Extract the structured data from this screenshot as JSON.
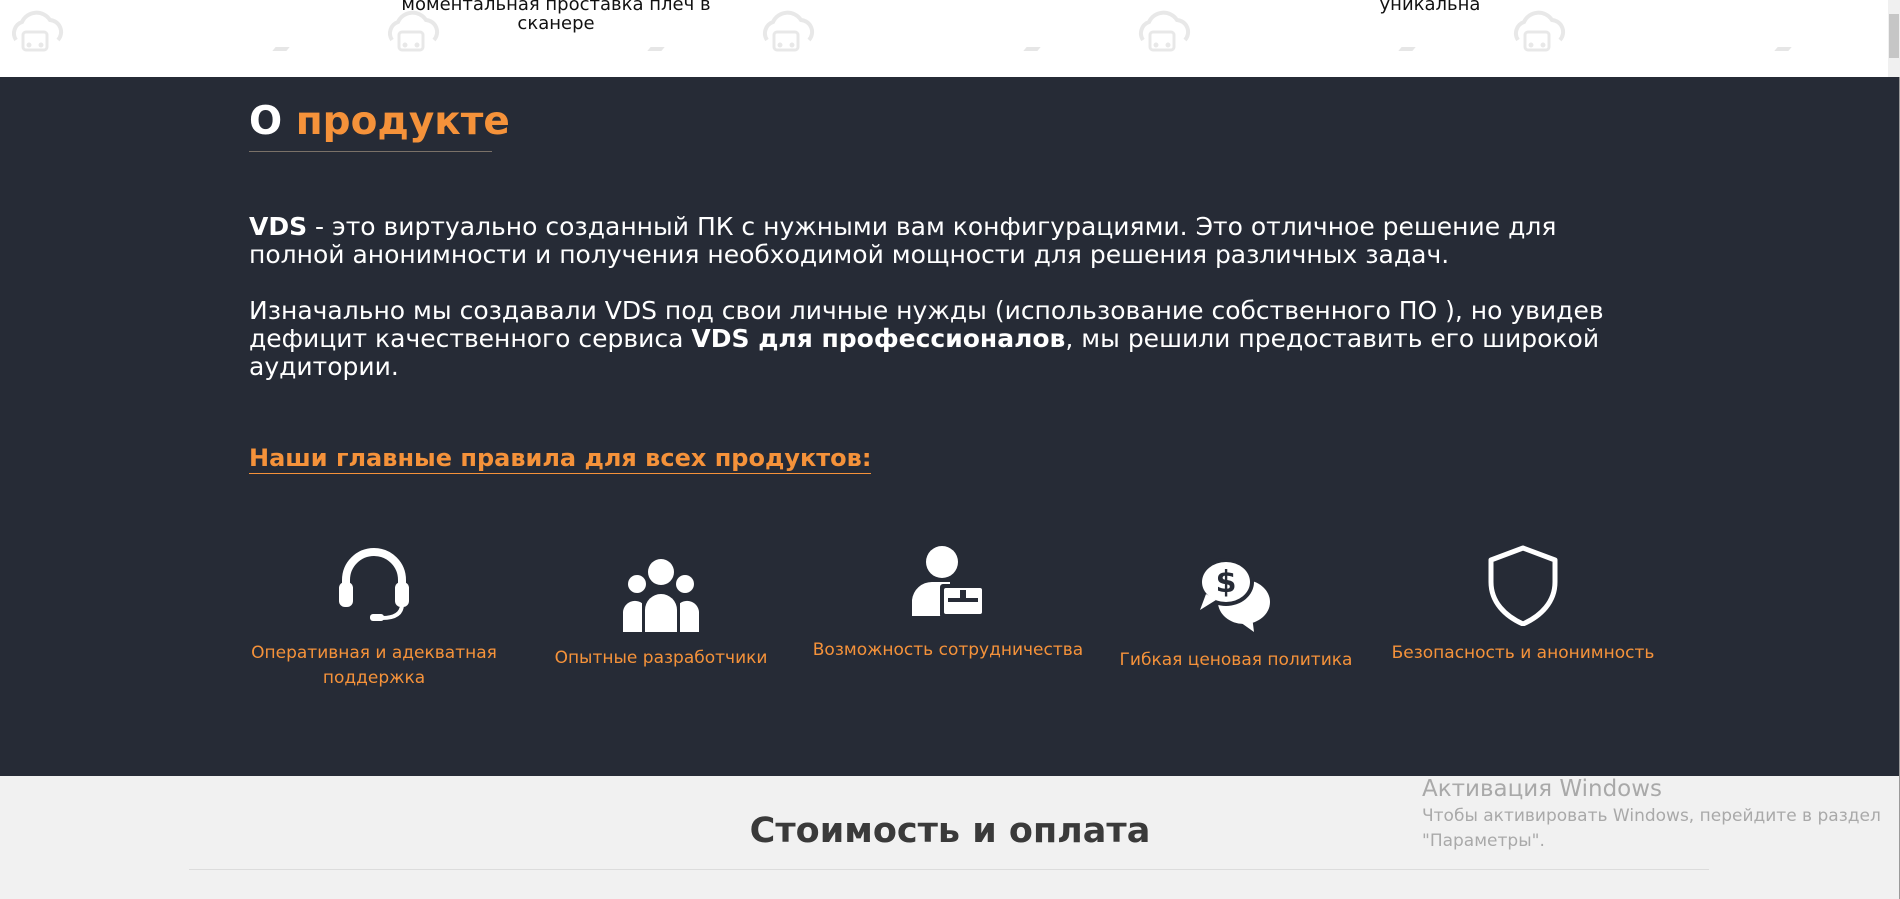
{
  "top_strip": {
    "captions": [
      "моментальная проставка плеч в сканере",
      "уникальна"
    ],
    "watermark_icon": "car-cloud-icon"
  },
  "about": {
    "title_white": "О",
    "title_orange": "продукте",
    "para1_bold": "VDS",
    "para1_rest": " - это виртуально созданный ПК с нужными вам конфигурациями. Это отличное решение для полной анонимности и получения необходимой мощности для решения различных задач.",
    "para2_start": "Изначально мы создавали VDS под свои личные нужды (использование собственного ПО ), но увидев дефицит качественного сервиса ",
    "para2_bold": "VDS для профессионалов",
    "para2_end": ", мы решили предоставить его широкой аудитории.",
    "rules_heading": "Наши главные правила для всех продуктов:",
    "features": [
      {
        "label": "Оперативная и адекватная поддержка",
        "icon": "headset-icon"
      },
      {
        "label": "Опытные разработчики",
        "icon": "team-icon"
      },
      {
        "label": "Возможность сотрудничества",
        "icon": "user-briefcase-icon"
      },
      {
        "label": "Гибкая ценовая политика",
        "icon": "dollar-chat-icon"
      },
      {
        "label": "Безопасность и анонимность",
        "icon": "shield-icon"
      }
    ]
  },
  "pricing": {
    "title": "Стоимость и оплата"
  },
  "windows_activation": {
    "title": "Активация Windows",
    "text": "Чтобы активировать Windows, перейдите в раздел \"Параметры\"."
  },
  "colors": {
    "accent": "#f5923a",
    "dark_bg": "#262b36",
    "light_bg": "#f1f1f1"
  }
}
